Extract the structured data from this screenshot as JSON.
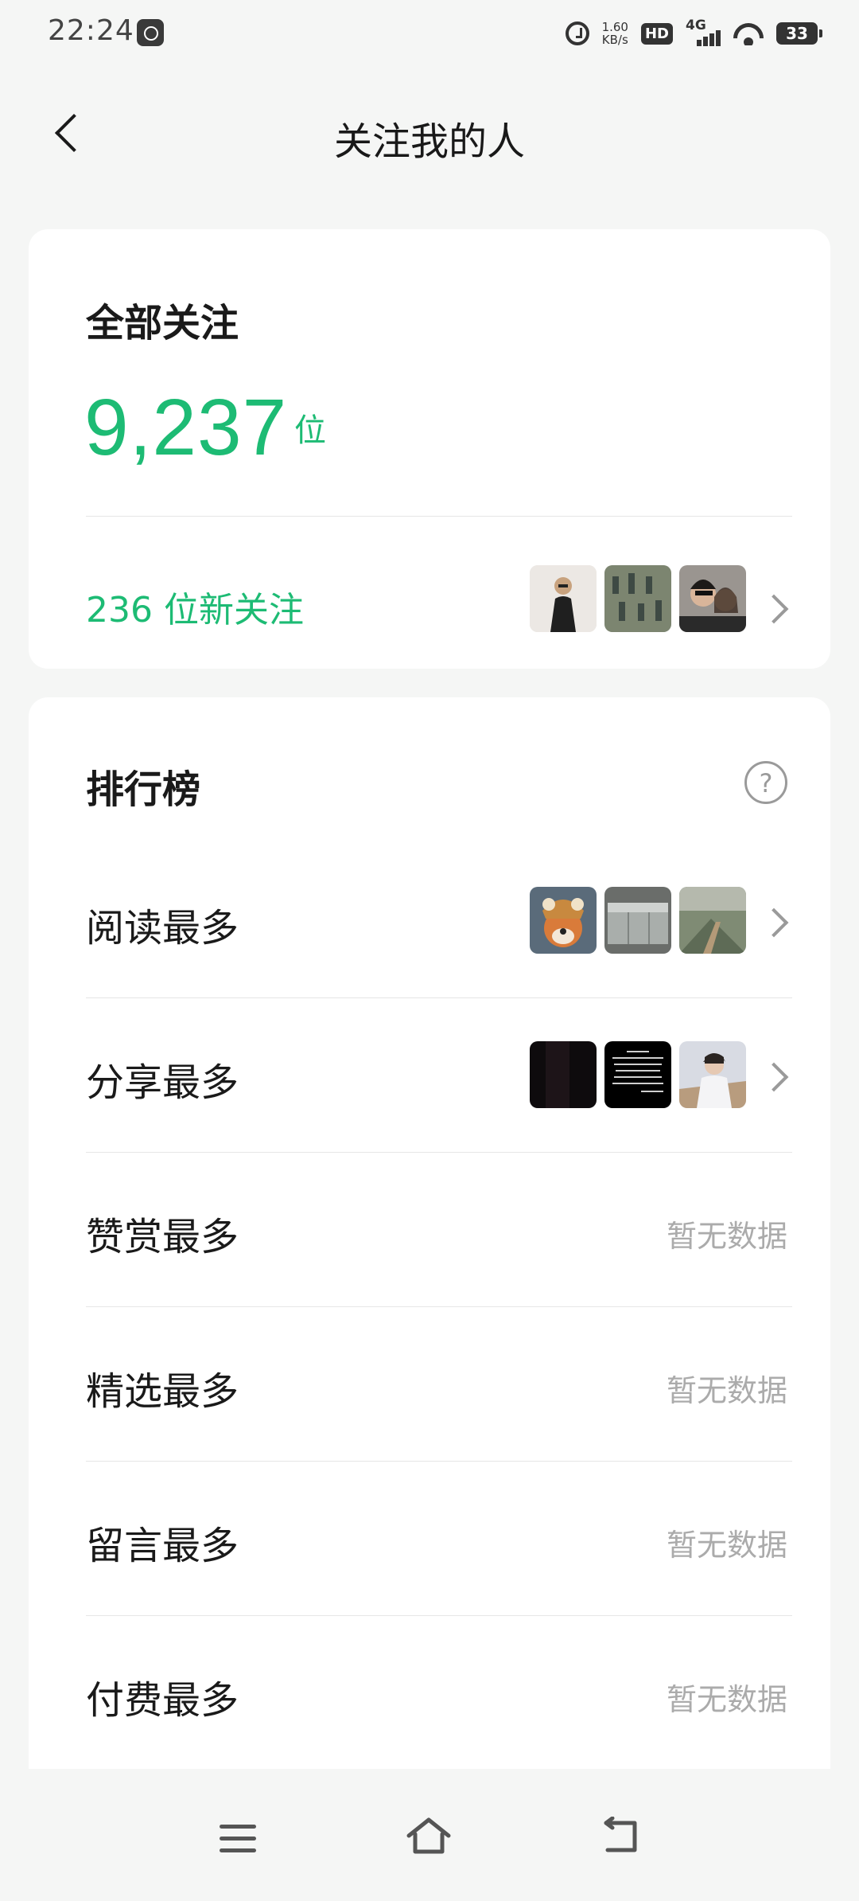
{
  "status_bar": {
    "time": "22:24",
    "speed_value": "1.60",
    "speed_unit": "KB/s",
    "hd": "HD",
    "network": "4G",
    "battery": "33"
  },
  "header": {
    "title": "关注我的人",
    "back_icon": "chevron-left-icon"
  },
  "summary": {
    "label": "全部关注",
    "count": "9,237",
    "unit": "位",
    "new_followers": "236 位新关注",
    "avatars": [
      "person-photo",
      "group-figurines-photo",
      "couple-selfie-photo"
    ]
  },
  "ranking": {
    "title": "排行榜",
    "help_icon": "question-circle-icon",
    "rows": [
      {
        "label": "阅读最多",
        "thumbs": [
          "dog-costume-photo",
          "kitchen-counter-photo",
          "outdoor-stairs-photo"
        ]
      },
      {
        "label": "分享最多",
        "thumbs": [
          "dark-photo",
          "text-screenshot-photo",
          "person-white-jacket-photo"
        ]
      },
      {
        "label": "赞赏最多",
        "empty": "暂无数据"
      },
      {
        "label": "精选最多",
        "empty": "暂无数据"
      },
      {
        "label": "留言最多",
        "empty": "暂无数据"
      },
      {
        "label": "付费最多",
        "empty": "暂无数据"
      }
    ]
  },
  "nav_bar": {
    "menu_icon": "menu-icon",
    "home_icon": "home-icon",
    "back_icon": "back-icon"
  },
  "colors": {
    "accent": "#1dbb74",
    "background": "#f5f6f5",
    "muted": "#ababab"
  }
}
